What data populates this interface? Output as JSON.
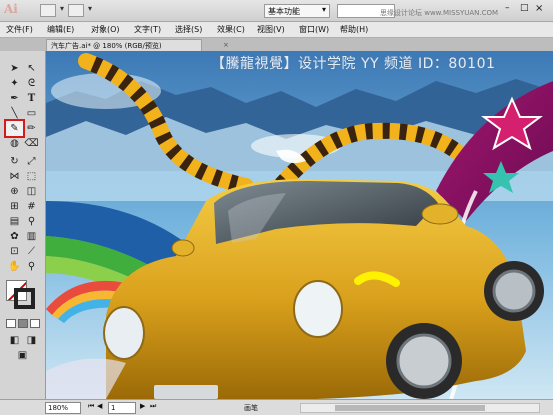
{
  "app": {
    "logo": "Ai",
    "workspace": "基本功能",
    "watermark": "思缘设计论坛 www.MISSYUAN.COM",
    "window_controls": {
      "minimize": "–",
      "maximize": "□",
      "close": "×"
    }
  },
  "menu": [
    {
      "label": "文件(F)"
    },
    {
      "label": "编辑(E)"
    },
    {
      "label": "对象(O)"
    },
    {
      "label": "文字(T)"
    },
    {
      "label": "选择(S)"
    },
    {
      "label": "效果(C)"
    },
    {
      "label": "视图(V)"
    },
    {
      "label": "窗口(W)"
    },
    {
      "label": "帮助(H)"
    }
  ],
  "document": {
    "tab_title": "汽车广告.ai* @ 180% (RGB/预览)",
    "close_label": "×"
  },
  "canvas": {
    "watermark": "【騰龍視覺】设计学院  YY 频道 ID：80101"
  },
  "tools": {
    "selected": "paintbrush-tool",
    "highlight_color": "#d41a1a"
  },
  "status": {
    "zoom": "180%",
    "page": "1",
    "tool_name": "画笔"
  }
}
